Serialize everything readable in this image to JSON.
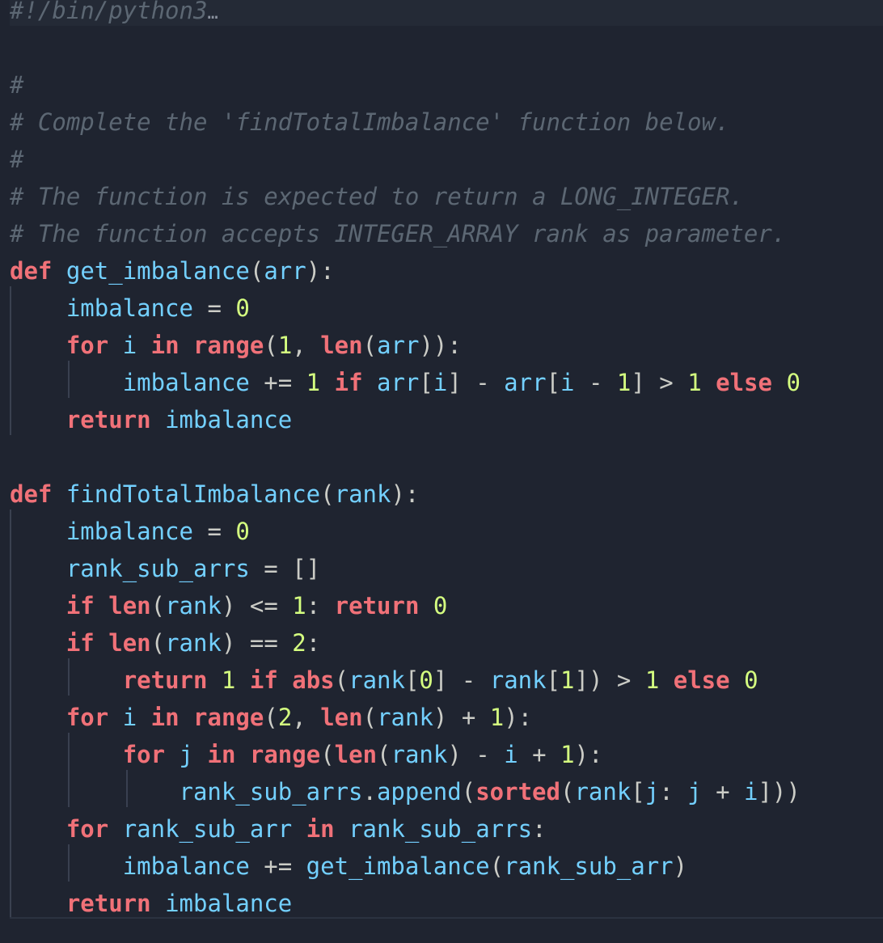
{
  "editor": {
    "lines": [
      {
        "tokens": [
          {
            "t": "#!/bin/python3",
            "c": "comment"
          },
          {
            "t": "…",
            "c": "fold"
          }
        ]
      },
      {
        "tokens": []
      },
      {
        "tokens": [
          {
            "t": "#",
            "c": "comment"
          }
        ]
      },
      {
        "tokens": [
          {
            "t": "# Complete the 'findTotalImbalance' function below.",
            "c": "comment"
          }
        ]
      },
      {
        "tokens": [
          {
            "t": "#",
            "c": "comment"
          }
        ]
      },
      {
        "tokens": [
          {
            "t": "# The function is expected to return a LONG_INTEGER.",
            "c": "comment"
          }
        ]
      },
      {
        "tokens": [
          {
            "t": "# The function accepts INTEGER_ARRAY rank as parameter.",
            "c": "comment"
          }
        ]
      },
      {
        "tokens": [
          {
            "t": "def",
            "c": "keyword"
          },
          {
            "t": " ",
            "c": "plain"
          },
          {
            "t": "get_imbalance",
            "c": "func"
          },
          {
            "t": "(",
            "c": "punct"
          },
          {
            "t": "arr",
            "c": "ident"
          },
          {
            "t": "):",
            "c": "punct"
          }
        ]
      },
      {
        "tokens": [
          {
            "t": "    ",
            "c": "plain"
          },
          {
            "t": "imbalance",
            "c": "ident"
          },
          {
            "t": " = ",
            "c": "punct"
          },
          {
            "t": "0",
            "c": "num"
          }
        ]
      },
      {
        "tokens": [
          {
            "t": "    ",
            "c": "plain"
          },
          {
            "t": "for",
            "c": "keyword"
          },
          {
            "t": " ",
            "c": "plain"
          },
          {
            "t": "i",
            "c": "ident"
          },
          {
            "t": " ",
            "c": "plain"
          },
          {
            "t": "in",
            "c": "keyword"
          },
          {
            "t": " ",
            "c": "plain"
          },
          {
            "t": "range",
            "c": "builtin"
          },
          {
            "t": "(",
            "c": "punct"
          },
          {
            "t": "1",
            "c": "num"
          },
          {
            "t": ", ",
            "c": "punct"
          },
          {
            "t": "len",
            "c": "builtin"
          },
          {
            "t": "(",
            "c": "punct"
          },
          {
            "t": "arr",
            "c": "ident"
          },
          {
            "t": ")):",
            "c": "punct"
          }
        ]
      },
      {
        "tokens": [
          {
            "t": "        ",
            "c": "plain"
          },
          {
            "t": "imbalance",
            "c": "ident"
          },
          {
            "t": " += ",
            "c": "punct"
          },
          {
            "t": "1",
            "c": "num"
          },
          {
            "t": " ",
            "c": "plain"
          },
          {
            "t": "if",
            "c": "keyword"
          },
          {
            "t": " ",
            "c": "plain"
          },
          {
            "t": "arr",
            "c": "ident"
          },
          {
            "t": "[",
            "c": "punct"
          },
          {
            "t": "i",
            "c": "ident"
          },
          {
            "t": "] - ",
            "c": "punct"
          },
          {
            "t": "arr",
            "c": "ident"
          },
          {
            "t": "[",
            "c": "punct"
          },
          {
            "t": "i",
            "c": "ident"
          },
          {
            "t": " - ",
            "c": "punct"
          },
          {
            "t": "1",
            "c": "num"
          },
          {
            "t": "] > ",
            "c": "punct"
          },
          {
            "t": "1",
            "c": "num"
          },
          {
            "t": " ",
            "c": "plain"
          },
          {
            "t": "else",
            "c": "keyword"
          },
          {
            "t": " ",
            "c": "plain"
          },
          {
            "t": "0",
            "c": "num"
          }
        ]
      },
      {
        "tokens": [
          {
            "t": "    ",
            "c": "plain"
          },
          {
            "t": "return",
            "c": "keyword"
          },
          {
            "t": " ",
            "c": "plain"
          },
          {
            "t": "imbalance",
            "c": "ident"
          }
        ]
      },
      {
        "tokens": []
      },
      {
        "tokens": [
          {
            "t": "def",
            "c": "keyword"
          },
          {
            "t": " ",
            "c": "plain"
          },
          {
            "t": "findTotalImbalance",
            "c": "func"
          },
          {
            "t": "(",
            "c": "punct"
          },
          {
            "t": "rank",
            "c": "ident"
          },
          {
            "t": "):",
            "c": "punct"
          }
        ]
      },
      {
        "tokens": [
          {
            "t": "    ",
            "c": "plain"
          },
          {
            "t": "imbalance",
            "c": "ident"
          },
          {
            "t": " = ",
            "c": "punct"
          },
          {
            "t": "0",
            "c": "num"
          }
        ]
      },
      {
        "tokens": [
          {
            "t": "    ",
            "c": "plain"
          },
          {
            "t": "rank_sub_arrs",
            "c": "ident"
          },
          {
            "t": " = []",
            "c": "punct"
          }
        ]
      },
      {
        "tokens": [
          {
            "t": "    ",
            "c": "plain"
          },
          {
            "t": "if",
            "c": "keyword"
          },
          {
            "t": " ",
            "c": "plain"
          },
          {
            "t": "len",
            "c": "builtin"
          },
          {
            "t": "(",
            "c": "punct"
          },
          {
            "t": "rank",
            "c": "ident"
          },
          {
            "t": ") <= ",
            "c": "punct"
          },
          {
            "t": "1",
            "c": "num"
          },
          {
            "t": ": ",
            "c": "punct"
          },
          {
            "t": "return",
            "c": "keyword"
          },
          {
            "t": " ",
            "c": "plain"
          },
          {
            "t": "0",
            "c": "num"
          }
        ]
      },
      {
        "tokens": [
          {
            "t": "    ",
            "c": "plain"
          },
          {
            "t": "if",
            "c": "keyword"
          },
          {
            "t": " ",
            "c": "plain"
          },
          {
            "t": "len",
            "c": "builtin"
          },
          {
            "t": "(",
            "c": "punct"
          },
          {
            "t": "rank",
            "c": "ident"
          },
          {
            "t": ") == ",
            "c": "punct"
          },
          {
            "t": "2",
            "c": "num"
          },
          {
            "t": ":",
            "c": "punct"
          }
        ]
      },
      {
        "tokens": [
          {
            "t": "        ",
            "c": "plain"
          },
          {
            "t": "return",
            "c": "keyword"
          },
          {
            "t": " ",
            "c": "plain"
          },
          {
            "t": "1",
            "c": "num"
          },
          {
            "t": " ",
            "c": "plain"
          },
          {
            "t": "if",
            "c": "keyword"
          },
          {
            "t": " ",
            "c": "plain"
          },
          {
            "t": "abs",
            "c": "builtin"
          },
          {
            "t": "(",
            "c": "punct"
          },
          {
            "t": "rank",
            "c": "ident"
          },
          {
            "t": "[",
            "c": "punct"
          },
          {
            "t": "0",
            "c": "num"
          },
          {
            "t": "] - ",
            "c": "punct"
          },
          {
            "t": "rank",
            "c": "ident"
          },
          {
            "t": "[",
            "c": "punct"
          },
          {
            "t": "1",
            "c": "num"
          },
          {
            "t": "]) > ",
            "c": "punct"
          },
          {
            "t": "1",
            "c": "num"
          },
          {
            "t": " ",
            "c": "plain"
          },
          {
            "t": "else",
            "c": "keyword"
          },
          {
            "t": " ",
            "c": "plain"
          },
          {
            "t": "0",
            "c": "num"
          }
        ]
      },
      {
        "tokens": [
          {
            "t": "    ",
            "c": "plain"
          },
          {
            "t": "for",
            "c": "keyword"
          },
          {
            "t": " ",
            "c": "plain"
          },
          {
            "t": "i",
            "c": "ident"
          },
          {
            "t": " ",
            "c": "plain"
          },
          {
            "t": "in",
            "c": "keyword"
          },
          {
            "t": " ",
            "c": "plain"
          },
          {
            "t": "range",
            "c": "builtin"
          },
          {
            "t": "(",
            "c": "punct"
          },
          {
            "t": "2",
            "c": "num"
          },
          {
            "t": ", ",
            "c": "punct"
          },
          {
            "t": "len",
            "c": "builtin"
          },
          {
            "t": "(",
            "c": "punct"
          },
          {
            "t": "rank",
            "c": "ident"
          },
          {
            "t": ") + ",
            "c": "punct"
          },
          {
            "t": "1",
            "c": "num"
          },
          {
            "t": "):",
            "c": "punct"
          }
        ]
      },
      {
        "tokens": [
          {
            "t": "        ",
            "c": "plain"
          },
          {
            "t": "for",
            "c": "keyword"
          },
          {
            "t": " ",
            "c": "plain"
          },
          {
            "t": "j",
            "c": "ident"
          },
          {
            "t": " ",
            "c": "plain"
          },
          {
            "t": "in",
            "c": "keyword"
          },
          {
            "t": " ",
            "c": "plain"
          },
          {
            "t": "range",
            "c": "builtin"
          },
          {
            "t": "(",
            "c": "punct"
          },
          {
            "t": "len",
            "c": "builtin"
          },
          {
            "t": "(",
            "c": "punct"
          },
          {
            "t": "rank",
            "c": "ident"
          },
          {
            "t": ") - ",
            "c": "punct"
          },
          {
            "t": "i",
            "c": "ident"
          },
          {
            "t": " + ",
            "c": "punct"
          },
          {
            "t": "1",
            "c": "num"
          },
          {
            "t": "):",
            "c": "punct"
          }
        ]
      },
      {
        "tokens": [
          {
            "t": "            ",
            "c": "plain"
          },
          {
            "t": "rank_sub_arrs",
            "c": "ident"
          },
          {
            "t": ".",
            "c": "punct"
          },
          {
            "t": "append",
            "c": "func"
          },
          {
            "t": "(",
            "c": "punct"
          },
          {
            "t": "sorted",
            "c": "builtin"
          },
          {
            "t": "(",
            "c": "punct"
          },
          {
            "t": "rank",
            "c": "ident"
          },
          {
            "t": "[",
            "c": "punct"
          },
          {
            "t": "j",
            "c": "ident"
          },
          {
            "t": ": ",
            "c": "punct"
          },
          {
            "t": "j",
            "c": "ident"
          },
          {
            "t": " + ",
            "c": "punct"
          },
          {
            "t": "i",
            "c": "ident"
          },
          {
            "t": "]))",
            "c": "punct"
          }
        ]
      },
      {
        "tokens": [
          {
            "t": "    ",
            "c": "plain"
          },
          {
            "t": "for",
            "c": "keyword"
          },
          {
            "t": " ",
            "c": "plain"
          },
          {
            "t": "rank_sub_arr",
            "c": "ident"
          },
          {
            "t": " ",
            "c": "plain"
          },
          {
            "t": "in",
            "c": "keyword"
          },
          {
            "t": " ",
            "c": "plain"
          },
          {
            "t": "rank_sub_arrs",
            "c": "ident"
          },
          {
            "t": ":",
            "c": "punct"
          }
        ]
      },
      {
        "tokens": [
          {
            "t": "        ",
            "c": "plain"
          },
          {
            "t": "imbalance",
            "c": "ident"
          },
          {
            "t": " += ",
            "c": "punct"
          },
          {
            "t": "get_imbalance",
            "c": "func"
          },
          {
            "t": "(",
            "c": "punct"
          },
          {
            "t": "rank_sub_arr",
            "c": "ident"
          },
          {
            "t": ")",
            "c": "punct"
          }
        ]
      },
      {
        "tokens": [
          {
            "t": "    ",
            "c": "plain"
          },
          {
            "t": "return",
            "c": "keyword"
          },
          {
            "t": " ",
            "c": "plain"
          },
          {
            "t": "imbalance",
            "c": "ident"
          }
        ]
      }
    ]
  },
  "colors": {
    "background": "#1f2430",
    "comment": "#5c6773",
    "keyword": "#f07178",
    "identifier": "#73d0ff",
    "number": "#d5ff80",
    "punctuation": "#cbccc6"
  }
}
